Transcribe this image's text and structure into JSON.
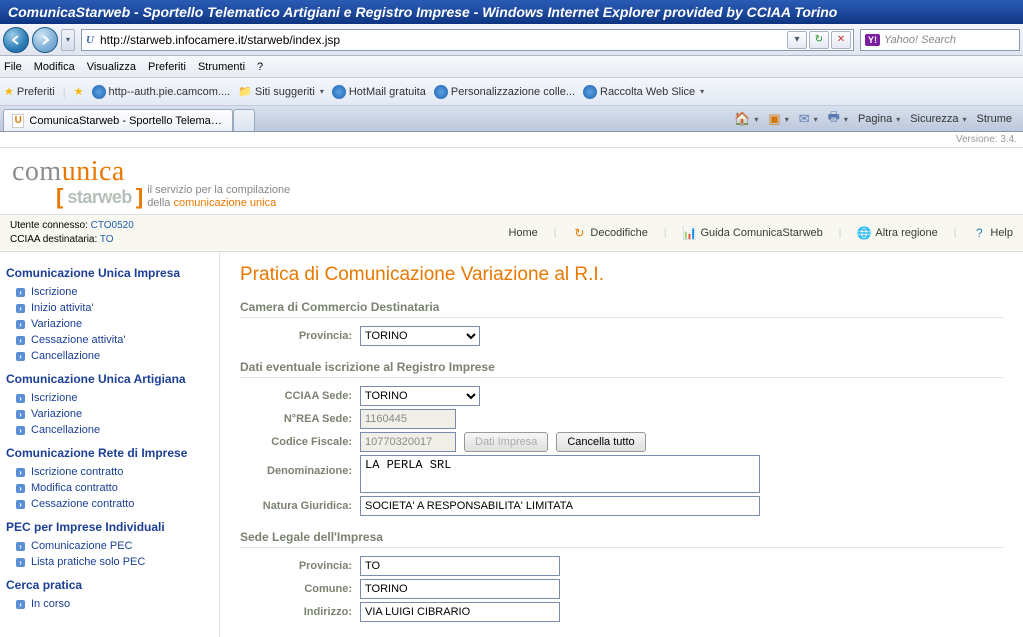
{
  "window": {
    "title": "ComunicaStarweb - Sportello Telematico Artigiani e Registro Imprese - Windows Internet Explorer provided by CCIAA Torino"
  },
  "address": {
    "url": "http://starweb.infocamere.it/starweb/index.jsp"
  },
  "search": {
    "placeholder": "Yahoo! Search"
  },
  "menubar": {
    "file": "File",
    "edit": "Modifica",
    "view": "Visualizza",
    "favorites": "Preferiti",
    "tools": "Strumenti",
    "help": "?"
  },
  "favbar": {
    "favorites": "Preferiti",
    "items": [
      {
        "label": "http--auth.pie.camcom...."
      },
      {
        "label": "Siti suggeriti"
      },
      {
        "label": "HotMail gratuita"
      },
      {
        "label": "Personalizzazione colle..."
      },
      {
        "label": "Raccolta Web Slice"
      }
    ]
  },
  "tab": {
    "title": "ComunicaStarweb - Sportello Telematico Art..."
  },
  "cmdbar": {
    "page": "Pagina",
    "safety": "Sicurezza",
    "tools": "Strume"
  },
  "version": "Versione: 3.4.",
  "logo": {
    "com": "com",
    "unica": "unica",
    "brand": "starweb",
    "tag1": "il servizio per la compilazione",
    "tag2": "della ",
    "tag2b": "comunicazione unica"
  },
  "session": {
    "user_label": "Utente connesso: ",
    "user": "CTO0520",
    "cciaa_label": "CCIAA destinataria: ",
    "cciaa": "TO"
  },
  "nav": {
    "home": "Home",
    "decodifiche": "Decodifiche",
    "guida": "Guida ComunicaStarweb",
    "regione": "Altra regione",
    "help": "Help"
  },
  "sidebar": {
    "g1": {
      "title": "Comunicazione Unica Impresa",
      "items": [
        "Iscrizione",
        "Inizio attivita'",
        "Variazione",
        "Cessazione attivita'",
        "Cancellazione"
      ]
    },
    "g2": {
      "title": "Comunicazione Unica Artigiana",
      "items": [
        "Iscrizione",
        "Variazione",
        "Cancellazione"
      ]
    },
    "g3": {
      "title": "Comunicazione Rete di Imprese",
      "items": [
        "Iscrizione contratto",
        "Modifica contratto",
        "Cessazione contratto"
      ]
    },
    "g4": {
      "title": "PEC per Imprese Individuali",
      "items": [
        "Comunicazione PEC",
        "Lista pratiche solo PEC"
      ]
    },
    "g5": {
      "title": "Cerca pratica",
      "items": [
        "In corso"
      ]
    }
  },
  "main": {
    "title": "Pratica di Comunicazione Variazione al R.I.",
    "sec1": {
      "title": "Camera di Commercio Destinataria",
      "provincia_label": "Provincia:",
      "provincia": "TORINO"
    },
    "sec2": {
      "title": "Dati eventuale iscrizione al Registro Imprese",
      "cciaa_label": "CCIAA Sede:",
      "cciaa": "TORINO",
      "rea_label": "N°REA Sede:",
      "rea": "1160445",
      "cf_label": "Codice Fiscale:",
      "cf": "10770320017",
      "btn_dati": "Dati Impresa",
      "btn_cancel": "Cancella tutto",
      "denom_label": "Denominazione:",
      "denom": "LA PERLA SRL",
      "natura_label": "Natura Giuridica:",
      "natura": "SOCIETA' A RESPONSABILITA' LIMITATA"
    },
    "sec3": {
      "title": "Sede Legale dell'Impresa",
      "prov_label": "Provincia:",
      "prov": "TO",
      "comune_label": "Comune:",
      "comune": "TORINO",
      "ind_label": "Indirizzo:",
      "ind": "VIA LUIGI CIBRARIO"
    }
  }
}
